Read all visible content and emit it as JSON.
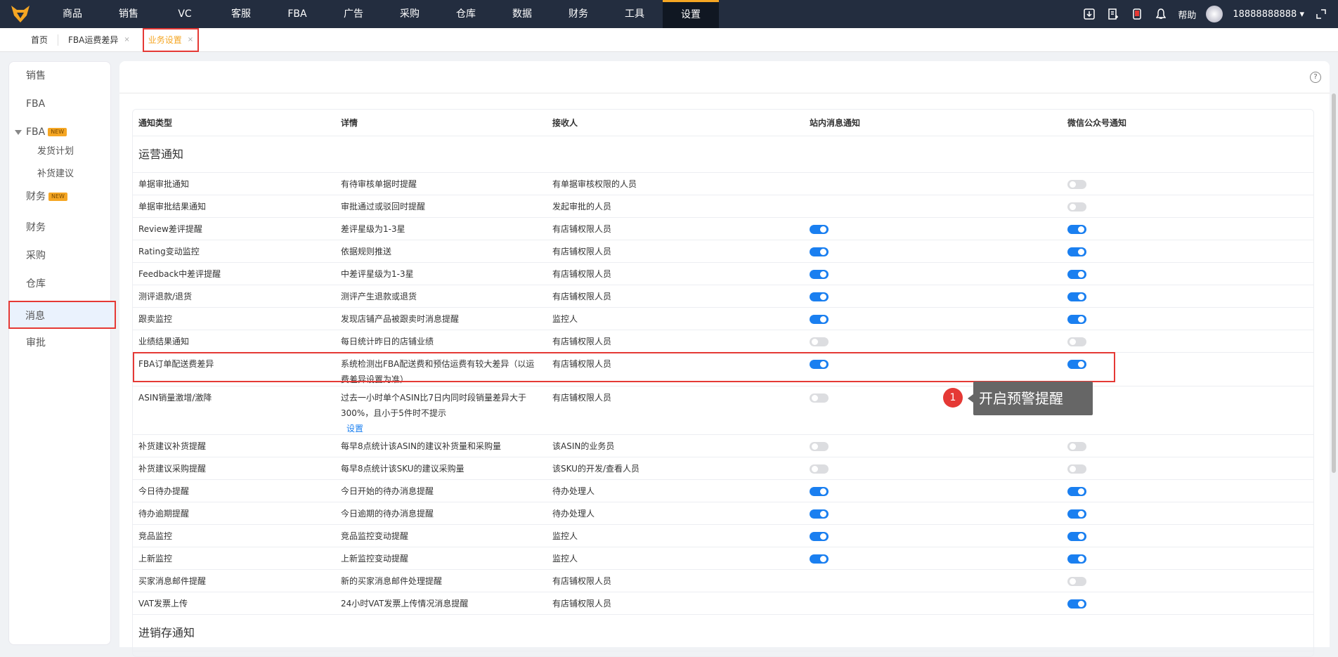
{
  "topnav": {
    "items": [
      "商品",
      "销售",
      "VC",
      "客服",
      "FBA",
      "广告",
      "采购",
      "仓库",
      "数据",
      "财务",
      "工具",
      "设置"
    ],
    "active": "设置",
    "help": "帮助",
    "user": "18888888888"
  },
  "tabs": [
    {
      "label": "首页"
    },
    {
      "label": "FBA运费差异",
      "close": "×"
    },
    {
      "label": "业务设置",
      "close": "×"
    }
  ],
  "sidebar": {
    "items": [
      {
        "label": "销售"
      },
      {
        "label": "FBA"
      },
      {
        "label": "FBA",
        "badge": "NEW"
      },
      {
        "label": "发货计划"
      },
      {
        "label": "补货建议"
      },
      {
        "label": "财务",
        "badge": "NEW"
      },
      {
        "label": "财务"
      },
      {
        "label": "采购"
      },
      {
        "label": "仓库"
      },
      {
        "label": "消息"
      },
      {
        "label": "审批"
      }
    ]
  },
  "help_icon": "?",
  "table": {
    "headers": [
      "通知类型",
      "详情",
      "接收人",
      "站内消息通知",
      "微信公众号通知"
    ],
    "sections": [
      "运营通知",
      "进销存通知"
    ],
    "rows": [
      {
        "type": "单据审批通知",
        "detail": "有待审核单据时提醒",
        "recipient": "有单据审核权限的人员",
        "site": null,
        "wechat": false
      },
      {
        "type": "单据审批结果通知",
        "detail": "审批通过或驳回时提醒",
        "recipient": "发起审批的人员",
        "site": null,
        "wechat": false
      },
      {
        "type": "Review差评提醒",
        "detail": "差评星级为1-3星",
        "recipient": "有店铺权限人员",
        "site": true,
        "wechat": true
      },
      {
        "type": "Rating变动监控",
        "detail": "依据规则推送",
        "recipient": "有店铺权限人员",
        "site": true,
        "wechat": true
      },
      {
        "type": "Feedback中差评提醒",
        "detail": "中差评星级为1-3星",
        "recipient": "有店铺权限人员",
        "site": true,
        "wechat": true
      },
      {
        "type": "测评退款/退货",
        "detail": "测评产生退款或退货",
        "recipient": "有店铺权限人员",
        "site": true,
        "wechat": true
      },
      {
        "type": "跟卖监控",
        "detail": "发现店铺产品被跟卖时消息提醒",
        "recipient": "监控人",
        "site": true,
        "wechat": true
      },
      {
        "type": "业绩结果通知",
        "detail": "每日统计昨日的店铺业绩",
        "recipient": "有店铺权限人员",
        "site": false,
        "wechat": false
      },
      {
        "type": "FBA订单配送费差异",
        "detail": "系统检测出FBA配送费和预估运费有较大差异（以运费差异设置为准）",
        "recipient": "有店铺权限人员",
        "site": true,
        "wechat": true
      },
      {
        "type": "ASIN销量激增/激降",
        "detail": "过去一小时单个ASIN比7日内同时段销量差异大于300%，且小于5件时不提示",
        "link": "设置",
        "recipient": "有店铺权限人员",
        "site": false,
        "wechat": null
      },
      {
        "type": "补货建议补货提醒",
        "detail": "每早8点统计该ASIN的建议补货量和采购量",
        "recipient": "该ASIN的业务员",
        "site": false,
        "wechat": false
      },
      {
        "type": "补货建议采购提醒",
        "detail": "每早8点统计该SKU的建议采购量",
        "recipient": "该SKU的开发/查看人员",
        "site": false,
        "wechat": false
      },
      {
        "type": "今日待办提醒",
        "detail": "今日开始的待办消息提醒",
        "recipient": "待办处理人",
        "site": true,
        "wechat": true
      },
      {
        "type": "待办逾期提醒",
        "detail": "今日逾期的待办消息提醒",
        "recipient": "待办处理人",
        "site": true,
        "wechat": true
      },
      {
        "type": "竞品监控",
        "detail": "竞品监控变动提醒",
        "recipient": "监控人",
        "site": true,
        "wechat": true
      },
      {
        "type": "上新监控",
        "detail": "上新监控变动提醒",
        "recipient": "监控人",
        "site": true,
        "wechat": true
      },
      {
        "type": "买家消息邮件提醒",
        "detail": "新的买家消息邮件处理提醒",
        "recipient": "有店铺权限人员",
        "site": null,
        "wechat": false
      },
      {
        "type": "VAT发票上传",
        "detail": "24小时VAT发票上传情况消息提醒",
        "recipient": "有店铺权限人员",
        "site": null,
        "wechat": true
      }
    ]
  },
  "annotation": {
    "step": "1",
    "text": "开启预警提醒"
  },
  "colors": {
    "accent": "#1a7ff0",
    "nav_bg": "#232d3f",
    "highlight": "#e53935",
    "active_tab": "#f5a623"
  }
}
